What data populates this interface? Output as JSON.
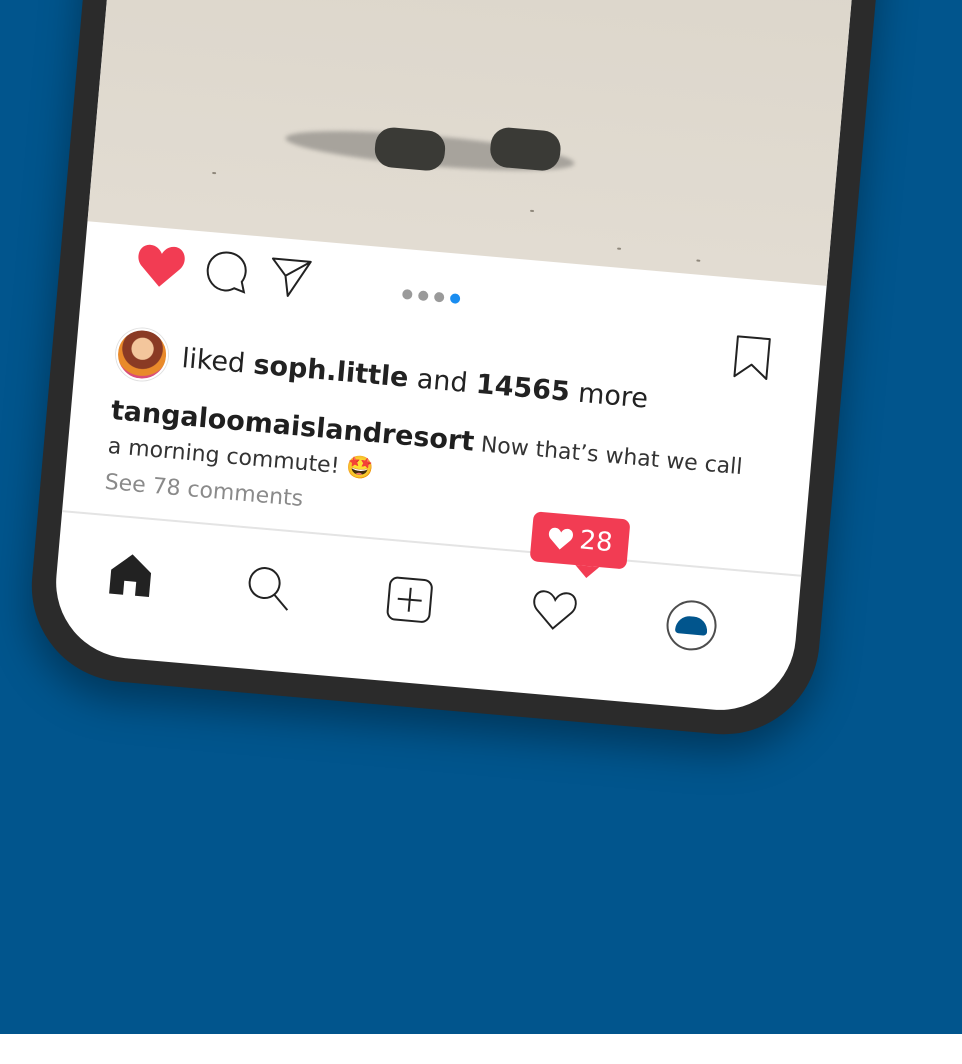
{
  "post": {
    "liked_by_prefix": "liked",
    "liked_by_user": "soph.little",
    "liked_and": "and",
    "liked_count": "14565",
    "liked_more": "more",
    "caption_user": "tangaloomaislandresort",
    "caption_text": "Now that’s what we call a morning commute! 🤩",
    "comments_link": "See 78 comments",
    "carousel": {
      "count": 4,
      "active_index": 3
    }
  },
  "notification": {
    "count": "28"
  },
  "colors": {
    "background": "#01558d",
    "like_red": "#f23c53",
    "active_dot": "#1a8df0",
    "phone_frame": "#2b2b2b"
  },
  "icons": {
    "like": "heart-filled-icon",
    "comment": "comment-bubble-icon",
    "share": "paper-plane-icon",
    "save": "bookmark-icon",
    "home": "home-icon",
    "search": "search-icon",
    "add": "add-post-icon",
    "activity": "heart-outline-icon",
    "profile": "profile-logo-icon"
  }
}
